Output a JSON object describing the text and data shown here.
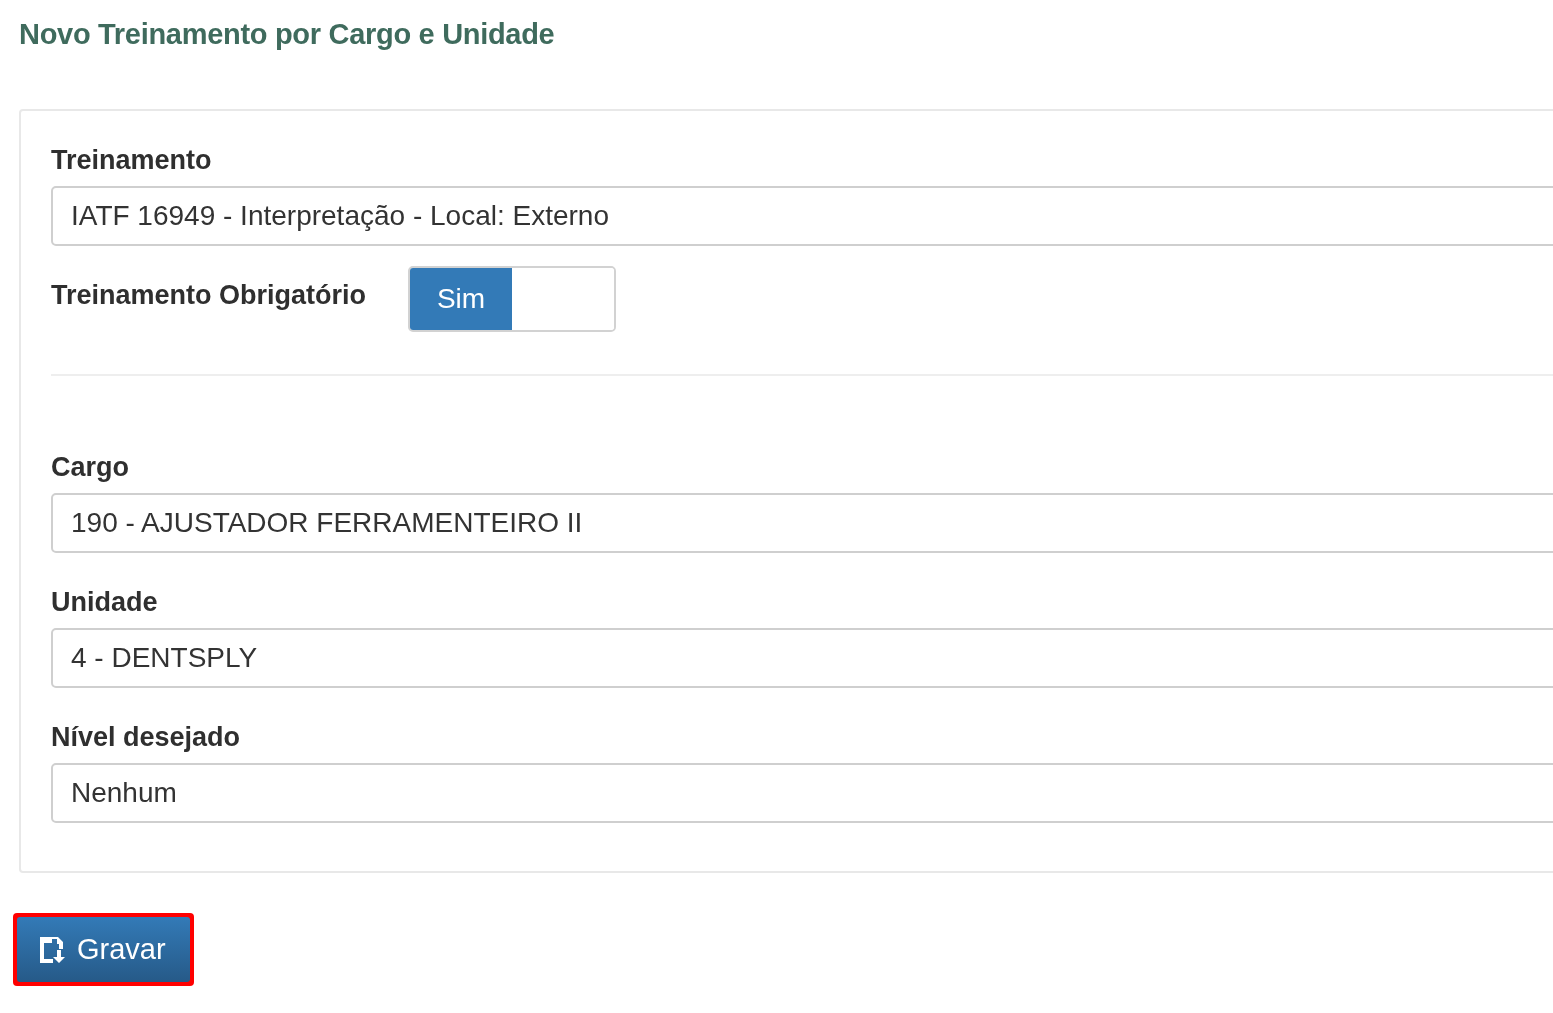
{
  "title": "Novo Treinamento por Cargo e Unidade",
  "training": {
    "label": "Treinamento",
    "value": "IATF 16949 - Interpretação - Local: Externo"
  },
  "mandatory": {
    "label": "Treinamento Obrigatório",
    "on_label": "Sim",
    "on": true
  },
  "fields": [
    {
      "label": "Cargo",
      "value": "190 - AJUSTADOR FERRAMENTEIRO II"
    },
    {
      "label": "Unidade",
      "value": "4 - DENTSPLY"
    },
    {
      "label": "Nível desejado",
      "value": "Nenhum"
    }
  ],
  "save_button": {
    "label": "Gravar",
    "highlighted": true
  }
}
